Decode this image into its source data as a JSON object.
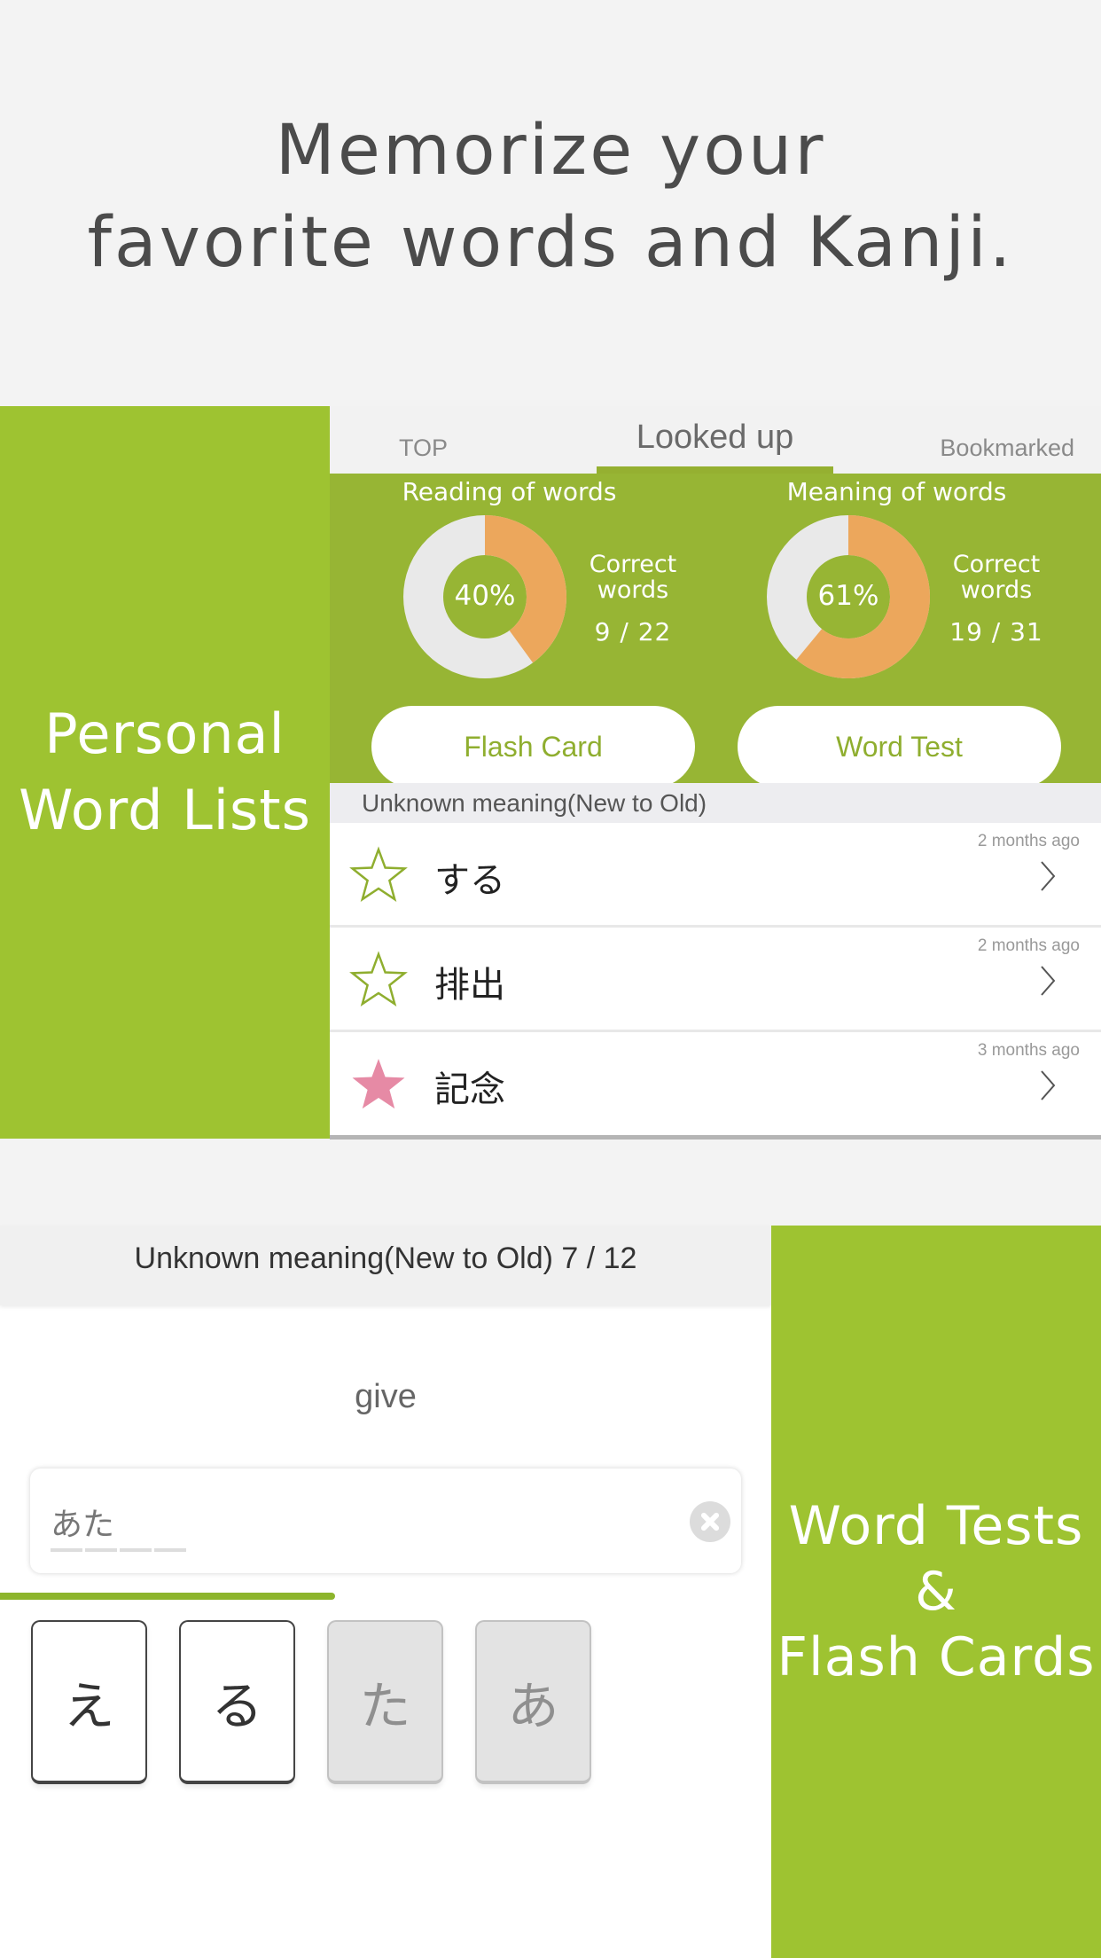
{
  "headline": {
    "line1": "Memorize your",
    "line2": "favorite words and Kanji."
  },
  "colors": {
    "brand_green": "#9ec331",
    "stats_green": "#97b534",
    "correct_orange": "#eca75c",
    "remaining_gray": "#e9e9e9",
    "bookmark_pink": "#e68aa5",
    "star_outline": "#8fae2f"
  },
  "section1": {
    "panel_title_line1": "Personal",
    "panel_title_line2": "Word Lists",
    "tabs": [
      {
        "label": "TOP",
        "active": false
      },
      {
        "label": "Looked up",
        "active": true
      },
      {
        "label": "Bookmarked",
        "active": false
      }
    ],
    "stats": [
      {
        "title": "Reading of words",
        "percent": 40,
        "percent_label": "40%",
        "correct_label_line1": "Correct",
        "correct_label_line2": "words",
        "count": "9 / 22",
        "correct": 9,
        "total": 22
      },
      {
        "title": "Meaning of words",
        "percent": 61,
        "percent_label": "61%",
        "correct_label_line1": "Correct",
        "correct_label_line2": "words",
        "count": "19 / 31",
        "correct": 19,
        "total": 31
      }
    ],
    "buttons": {
      "flash_card": "Flash Card",
      "word_test": "Word Test"
    },
    "list_header": "Unknown meaning(New to Old)",
    "rows": [
      {
        "word": "する",
        "time": "2 months ago",
        "bookmarked": false
      },
      {
        "word": "排出",
        "time": "2 months ago",
        "bookmarked": false
      },
      {
        "word": "記念",
        "time": "3 months ago",
        "bookmarked": true
      }
    ]
  },
  "section2": {
    "panel_title_line1": "Word Tests",
    "panel_title_line2": "&",
    "panel_title_line3": "Flash Cards",
    "header": "Unknown meaning(New to Old)  7 / 12",
    "prompt": "give",
    "answer_value": "あた",
    "answer_blanks": 4,
    "progress_fraction": 0.435,
    "cards": [
      {
        "kana": "え",
        "used": false
      },
      {
        "kana": "る",
        "used": false
      },
      {
        "kana": "た",
        "used": true
      },
      {
        "kana": "あ",
        "used": true
      }
    ]
  }
}
